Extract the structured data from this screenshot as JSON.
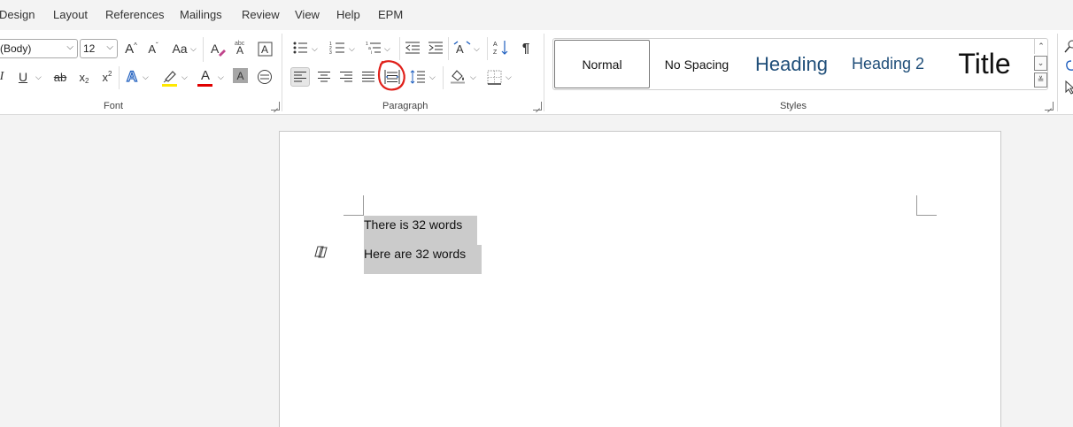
{
  "menu": {
    "items": [
      "Design",
      "Layout",
      "References",
      "Mailings",
      "Review",
      "View",
      "Help",
      "EPM"
    ]
  },
  "font_group": {
    "font_name": "(Body)",
    "font_size": "12",
    "grow_label": "A",
    "shrink_label": "A",
    "change_case_label": "Aa",
    "underline_label": "U",
    "strike_label": "ab",
    "subscript_label": "x",
    "superscript_label": "x",
    "text_effects_label": "A",
    "font_color_label": "A",
    "char_shading_label": "A",
    "italic_label": "I",
    "group_label": "Font",
    "highlight_color": "#ffe800",
    "font_color": "#e00000"
  },
  "paragraph_group": {
    "pilcrow_label": "¶",
    "group_label": "Paragraph"
  },
  "styles_group": {
    "styles": [
      "Normal",
      "No Spacing",
      "Heading",
      "Heading 2",
      "Title"
    ],
    "selected": "Normal",
    "group_label": "Styles",
    "heading_color": "#1f4e79"
  },
  "document": {
    "lines": [
      "There is 32 words",
      "Here are 32 words"
    ]
  },
  "annotation": {
    "color": "#e0201a"
  }
}
